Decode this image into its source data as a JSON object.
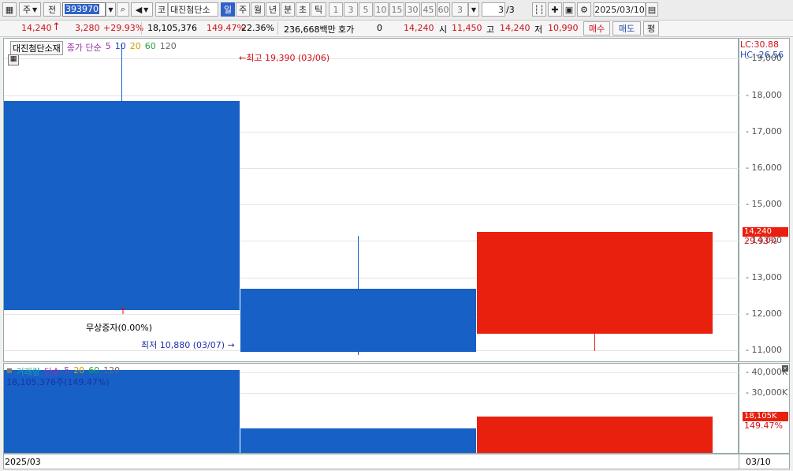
{
  "toolbar": {
    "market": "주",
    "scope": "전",
    "code": "393970",
    "kind": "코",
    "name": "대진첨단소",
    "periods": [
      "일",
      "주",
      "월",
      "년",
      "분",
      "초",
      "틱"
    ],
    "minutes": [
      "1",
      "3",
      "5",
      "10",
      "15",
      "30",
      "45",
      "60"
    ],
    "count_select": "3",
    "page": "3",
    "page_total": "/3",
    "date": "2025/03/10"
  },
  "quote": {
    "price": "14,240",
    "change": "3,280",
    "change_pct": "+29.93%",
    "volume": "18,105,376",
    "volume_pct": "149.47%",
    "turnover": "22.36%",
    "amount": "236,668백만",
    "hoga_label": "호가",
    "hoga_value": "0",
    "hoga_price": "14,240",
    "open_label": "시",
    "open": "11,450",
    "high_label": "고",
    "high": "14,240",
    "low_label": "저",
    "low": "10,990",
    "buy_label": "매수",
    "sell_label": "매도",
    "flat_label": "평"
  },
  "price_panel": {
    "legend_name": "대진첨단소재",
    "legend_ma": "종가 단순",
    "ma_periods": [
      {
        "p": "5",
        "color": "#9b2fa8"
      },
      {
        "p": "10",
        "color": "#2040c0"
      },
      {
        "p": "20",
        "color": "#c8a000"
      },
      {
        "p": "60",
        "color": "#20a040"
      },
      {
        "p": "120",
        "color": "#666666"
      }
    ],
    "high_note": "최고 19,390 (03/06)",
    "low_note": "최저 10,880 (03/07)",
    "event_note": "무상증자(0.00%)"
  },
  "price_axis": {
    "lc": "LC:30.88",
    "hc": "HC:-26.56",
    "current_tag": "14,240",
    "current_pct": "29.93%"
  },
  "volume_panel": {
    "legend_name": "거래량",
    "legend_ma": "단순",
    "ma_periods": [
      {
        "p": "5",
        "color": "#9b2fa8"
      },
      {
        "p": "20",
        "color": "#c8a000"
      },
      {
        "p": "60",
        "color": "#20a040"
      },
      {
        "p": "120",
        "color": "#666666"
      }
    ],
    "value_note": "18,105,376주(149.47%)"
  },
  "volume_axis": {
    "current_tag": "18,105K",
    "current_pct": "149.47%"
  },
  "date_bar": {
    "left_label": "2025/03",
    "right_label": "03/10"
  },
  "chart_data": {
    "type": "candlestick",
    "price_ticks": [
      11000,
      12000,
      13000,
      14000,
      15000,
      16000,
      17000,
      18000,
      19000
    ],
    "price_tick_labels": [
      "11,000",
      "12,000",
      "13,000",
      "14,000",
      "15,000",
      "16,000",
      "17,000",
      "18,000",
      "19,000"
    ],
    "price_range": [
      10700,
      19550
    ],
    "candles": [
      {
        "open": 17850,
        "high": 19390,
        "low": 12100,
        "close": 12100,
        "color": "blue"
      },
      {
        "open": 12700,
        "high": 14150,
        "low": 10880,
        "close": 10960,
        "color": "blue"
      },
      {
        "open": 11450,
        "high": 14240,
        "low": 10990,
        "close": 14240,
        "color": "red"
      }
    ],
    "volume_ticks": [
      40000,
      30000
    ],
    "volume_tick_labels": [
      "40,000K",
      "30,000K"
    ],
    "volume_range": [
      0,
      44500
    ],
    "volumes_k": [
      41200,
      12100,
      18105
    ],
    "volume_colors": [
      "blue",
      "blue",
      "red"
    ]
  }
}
